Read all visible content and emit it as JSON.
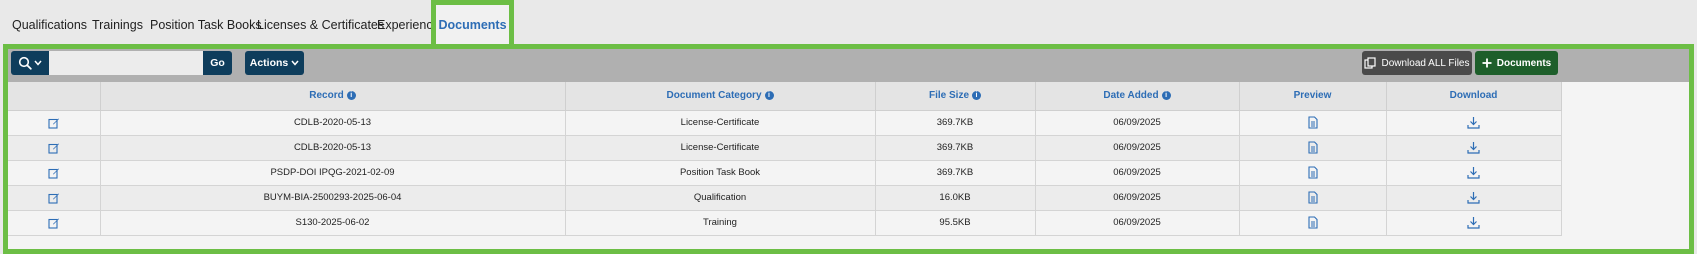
{
  "tabs": [
    {
      "label": "Qualifications"
    },
    {
      "label": "Trainings"
    },
    {
      "label": "Position Task Books"
    },
    {
      "label": "Licenses & Certificates"
    },
    {
      "label": "Experience"
    },
    {
      "label": "Documents",
      "active": true
    }
  ],
  "toolbar": {
    "search_placeholder": "",
    "search_value": "",
    "go_label": "Go",
    "actions_label": "Actions",
    "download_all_label": "Download ALL Files",
    "add_documents_label": "Documents"
  },
  "table": {
    "columns": [
      "",
      "Record",
      "Document Category",
      "File Size",
      "Date Added",
      "Preview",
      "Download"
    ],
    "rows": [
      {
        "record": "CDLB-2020-05-13",
        "category": "License-Certificate",
        "size": "369.7KB",
        "date": "06/09/2025"
      },
      {
        "record": "CDLB-2020-05-13",
        "category": "License-Certificate",
        "size": "369.7KB",
        "date": "06/09/2025"
      },
      {
        "record": "PSDP-DOI IPQG-2021-02-09",
        "category": "Position Task Book",
        "size": "369.7KB",
        "date": "06/09/2025"
      },
      {
        "record": "BUYM-BIA-2500293-2025-06-04",
        "category": "Qualification",
        "size": "16.0KB",
        "date": "06/09/2025"
      },
      {
        "record": "S130-2025-06-02",
        "category": "Training",
        "size": "95.5KB",
        "date": "06/09/2025"
      }
    ]
  },
  "colors": {
    "accent_blue": "#2d6db5",
    "navy_button": "#0e3d5c",
    "green_button": "#1d5e2a",
    "highlight_green": "#6cbe45",
    "gray_button": "#4a4a4a"
  }
}
